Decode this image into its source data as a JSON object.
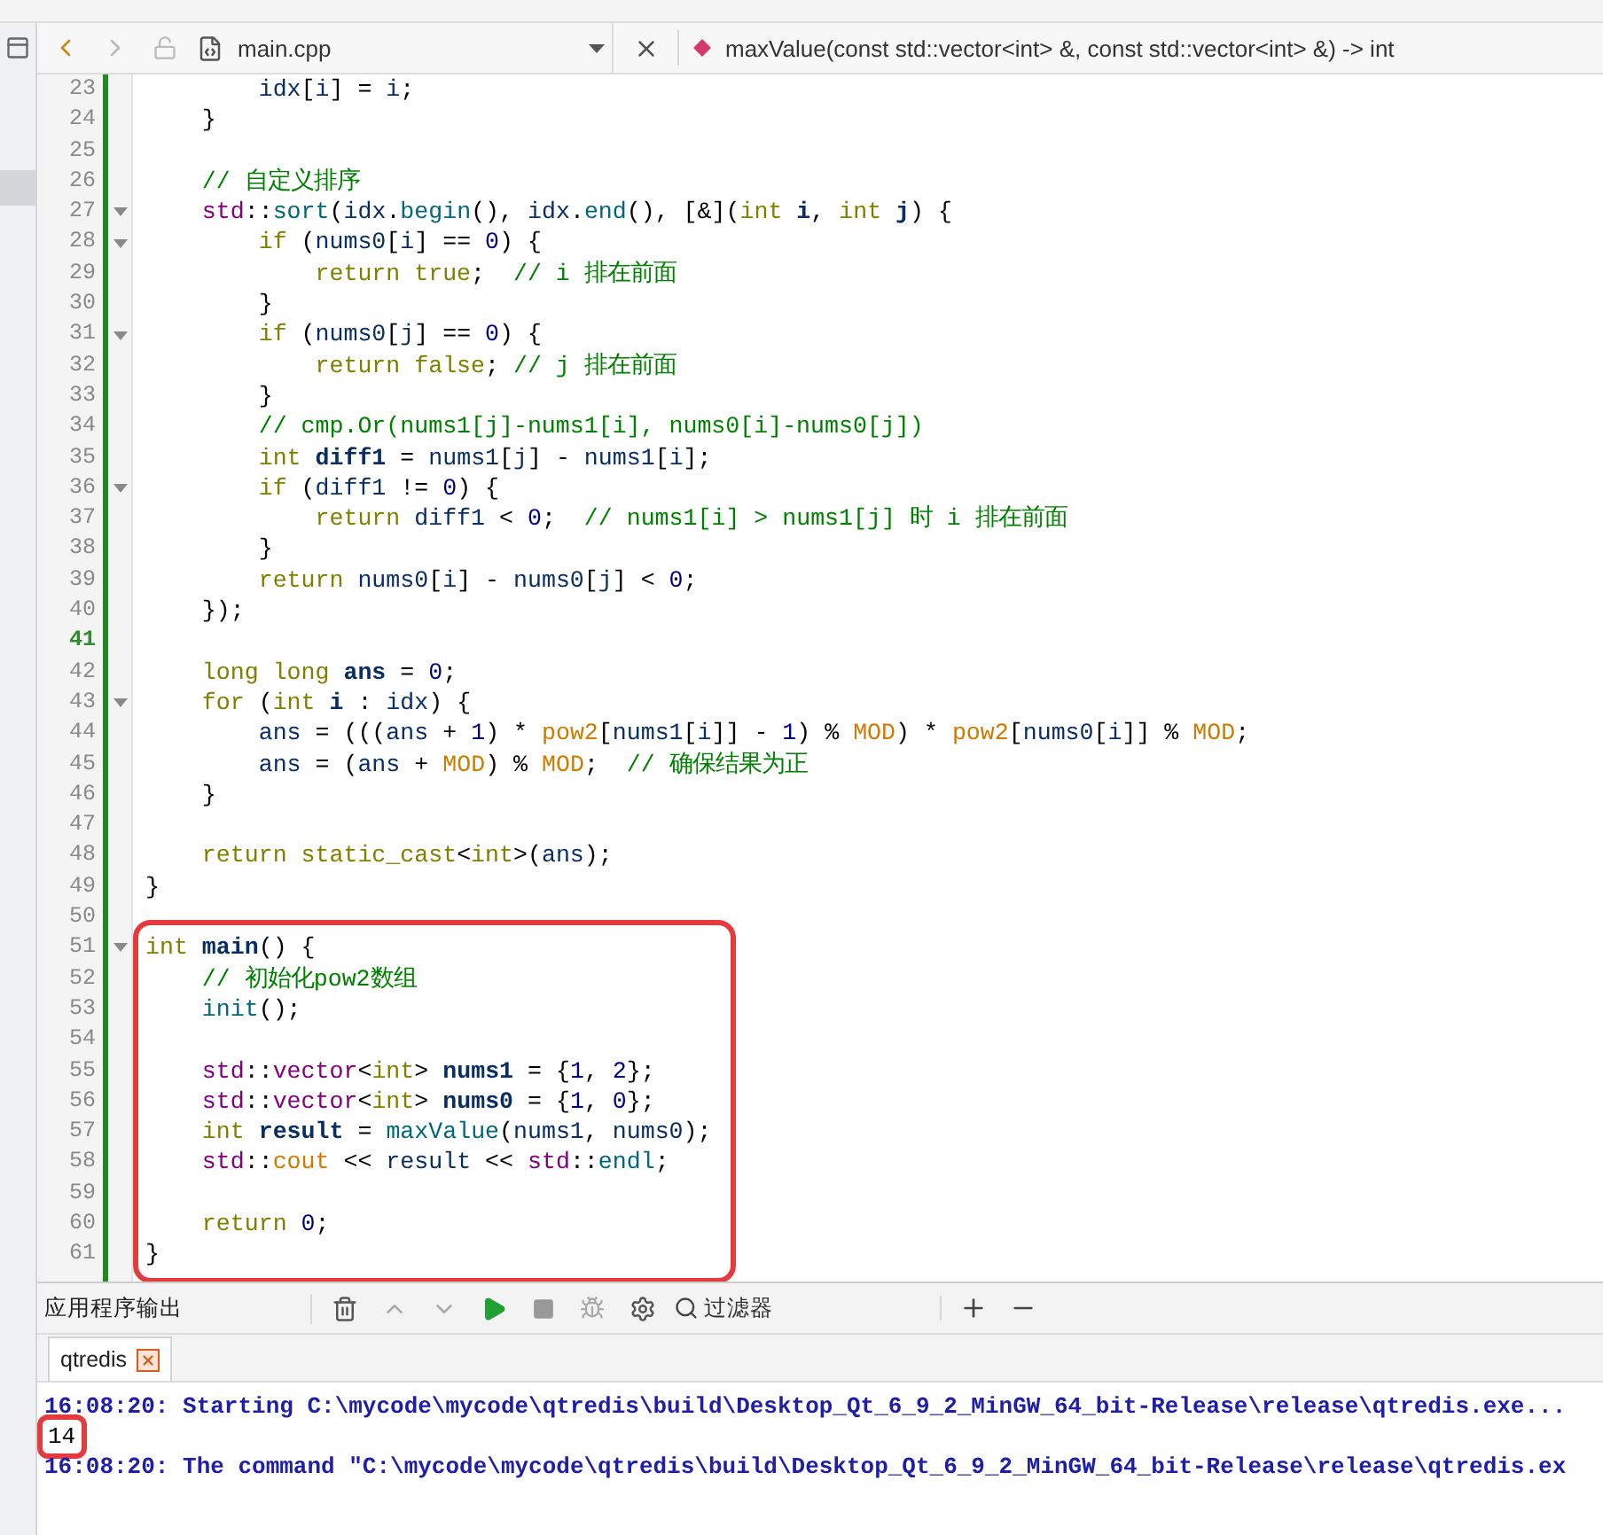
{
  "editor_toolbar": {
    "file_name": "main.cpp",
    "function_signature": "maxValue(const std::vector<int> &, const std::vector<int> &) -> int"
  },
  "code": {
    "lines": [
      {
        "number": "23",
        "fold": false,
        "current": false,
        "boxed": false,
        "tokens": [
          {
            "kind": "v",
            "text": "        idx"
          },
          {
            "kind": "p",
            "text": "["
          },
          {
            "kind": "v",
            "text": "i"
          },
          {
            "kind": "p",
            "text": "] = "
          },
          {
            "kind": "v",
            "text": "i"
          },
          {
            "kind": "p",
            "text": ";"
          }
        ]
      },
      {
        "number": "24",
        "fold": false,
        "current": false,
        "boxed": false,
        "tokens": [
          {
            "kind": "p",
            "text": "    }"
          }
        ]
      },
      {
        "number": "25",
        "fold": false,
        "current": false,
        "boxed": false
      },
      {
        "number": "26",
        "fold": false,
        "current": false,
        "boxed": false,
        "tokens": [
          {
            "kind": "c",
            "text": "    // 自定义排序"
          }
        ]
      },
      {
        "number": "27",
        "fold": true,
        "current": false,
        "boxed": false,
        "tokens": [
          {
            "kind": "s",
            "text": "    std"
          },
          {
            "kind": "p",
            "text": "::"
          },
          {
            "kind": "f",
            "text": "sort"
          },
          {
            "kind": "p",
            "text": "("
          },
          {
            "kind": "v",
            "text": "idx"
          },
          {
            "kind": "p",
            "text": "."
          },
          {
            "kind": "f",
            "text": "begin"
          },
          {
            "kind": "p",
            "text": "(), "
          },
          {
            "kind": "v",
            "text": "idx"
          },
          {
            "kind": "p",
            "text": "."
          },
          {
            "kind": "f",
            "text": "end"
          },
          {
            "kind": "p",
            "text": "(), [&]("
          },
          {
            "kind": "k",
            "text": "int "
          },
          {
            "kind": "d",
            "text": "i"
          },
          {
            "kind": "p",
            "text": ", "
          },
          {
            "kind": "k",
            "text": "int "
          },
          {
            "kind": "d",
            "text": "j"
          },
          {
            "kind": "p",
            "text": ") {"
          }
        ]
      },
      {
        "number": "28",
        "fold": true,
        "current": false,
        "boxed": false,
        "tokens": [
          {
            "kind": "k",
            "text": "        if"
          },
          {
            "kind": "p",
            "text": " ("
          },
          {
            "kind": "v",
            "text": "nums0"
          },
          {
            "kind": "p",
            "text": "["
          },
          {
            "kind": "v",
            "text": "i"
          },
          {
            "kind": "p",
            "text": "] == "
          },
          {
            "kind": "n",
            "text": "0"
          },
          {
            "kind": "p",
            "text": ") {"
          }
        ]
      },
      {
        "number": "29",
        "fold": false,
        "current": false,
        "boxed": false,
        "tokens": [
          {
            "kind": "k",
            "text": "            return true"
          },
          {
            "kind": "p",
            "text": ";  "
          },
          {
            "kind": "c",
            "text": "// i 排在前面"
          }
        ]
      },
      {
        "number": "30",
        "fold": false,
        "current": false,
        "boxed": false,
        "tokens": [
          {
            "kind": "p",
            "text": "        }"
          }
        ]
      },
      {
        "number": "31",
        "fold": true,
        "current": false,
        "boxed": false,
        "tokens": [
          {
            "kind": "k",
            "text": "        if"
          },
          {
            "kind": "p",
            "text": " ("
          },
          {
            "kind": "v",
            "text": "nums0"
          },
          {
            "kind": "p",
            "text": "["
          },
          {
            "kind": "v",
            "text": "j"
          },
          {
            "kind": "p",
            "text": "] == "
          },
          {
            "kind": "n",
            "text": "0"
          },
          {
            "kind": "p",
            "text": ") {"
          }
        ]
      },
      {
        "number": "32",
        "fold": false,
        "current": false,
        "boxed": false,
        "tokens": [
          {
            "kind": "k",
            "text": "            return false"
          },
          {
            "kind": "p",
            "text": "; "
          },
          {
            "kind": "c",
            "text": "// j 排在前面"
          }
        ]
      },
      {
        "number": "33",
        "fold": false,
        "current": false,
        "boxed": false,
        "tokens": [
          {
            "kind": "p",
            "text": "        }"
          }
        ]
      },
      {
        "number": "34",
        "fold": false,
        "current": false,
        "boxed": false,
        "tokens": [
          {
            "kind": "c",
            "text": "        // cmp.Or(nums1[j]-nums1[i], nums0[i]-nums0[j])"
          }
        ]
      },
      {
        "number": "35",
        "fold": false,
        "current": false,
        "boxed": false,
        "tokens": [
          {
            "kind": "k",
            "text": "        int "
          },
          {
            "kind": "d",
            "text": "diff1"
          },
          {
            "kind": "p",
            "text": " = "
          },
          {
            "kind": "v",
            "text": "nums1"
          },
          {
            "kind": "p",
            "text": "["
          },
          {
            "kind": "v",
            "text": "j"
          },
          {
            "kind": "p",
            "text": "] - "
          },
          {
            "kind": "v",
            "text": "nums1"
          },
          {
            "kind": "p",
            "text": "["
          },
          {
            "kind": "v",
            "text": "i"
          },
          {
            "kind": "p",
            "text": "];"
          }
        ]
      },
      {
        "number": "36",
        "fold": true,
        "current": false,
        "boxed": false,
        "tokens": [
          {
            "kind": "k",
            "text": "        if"
          },
          {
            "kind": "p",
            "text": " ("
          },
          {
            "kind": "v",
            "text": "diff1"
          },
          {
            "kind": "p",
            "text": " != "
          },
          {
            "kind": "n",
            "text": "0"
          },
          {
            "kind": "p",
            "text": ") {"
          }
        ]
      },
      {
        "number": "37",
        "fold": false,
        "current": false,
        "boxed": false,
        "tokens": [
          {
            "kind": "k",
            "text": "            return "
          },
          {
            "kind": "v",
            "text": "diff1"
          },
          {
            "kind": "p",
            "text": " < "
          },
          {
            "kind": "n",
            "text": "0"
          },
          {
            "kind": "p",
            "text": ";  "
          },
          {
            "kind": "c",
            "text": "// nums1[i] > nums1[j] 时 i 排在前面"
          }
        ]
      },
      {
        "number": "38",
        "fold": false,
        "current": false,
        "boxed": false,
        "tokens": [
          {
            "kind": "p",
            "text": "        }"
          }
        ]
      },
      {
        "number": "39",
        "fold": false,
        "current": false,
        "boxed": false,
        "tokens": [
          {
            "kind": "k",
            "text": "        return "
          },
          {
            "kind": "v",
            "text": "nums0"
          },
          {
            "kind": "p",
            "text": "["
          },
          {
            "kind": "v",
            "text": "i"
          },
          {
            "kind": "p",
            "text": "] - "
          },
          {
            "kind": "v",
            "text": "nums0"
          },
          {
            "kind": "p",
            "text": "["
          },
          {
            "kind": "v",
            "text": "j"
          },
          {
            "kind": "p",
            "text": "] < "
          },
          {
            "kind": "n",
            "text": "0"
          },
          {
            "kind": "p",
            "text": ";"
          }
        ]
      },
      {
        "number": "40",
        "fold": false,
        "current": false,
        "boxed": false,
        "tokens": [
          {
            "kind": "p",
            "text": "    });"
          }
        ]
      },
      {
        "number": "41",
        "fold": false,
        "current": true,
        "boxed": false
      },
      {
        "number": "42",
        "fold": false,
        "current": false,
        "boxed": false,
        "tokens": [
          {
            "kind": "k",
            "text": "    long long "
          },
          {
            "kind": "d",
            "text": "ans"
          },
          {
            "kind": "p",
            "text": " = "
          },
          {
            "kind": "n",
            "text": "0"
          },
          {
            "kind": "p",
            "text": ";"
          }
        ]
      },
      {
        "number": "43",
        "fold": true,
        "current": false,
        "boxed": false,
        "tokens": [
          {
            "kind": "k",
            "text": "    for"
          },
          {
            "kind": "p",
            "text": " ("
          },
          {
            "kind": "k",
            "text": "int "
          },
          {
            "kind": "d",
            "text": "i"
          },
          {
            "kind": "p",
            "text": " : "
          },
          {
            "kind": "v",
            "text": "idx"
          },
          {
            "kind": "p",
            "text": ") {"
          }
        ]
      },
      {
        "number": "44",
        "fold": false,
        "current": false,
        "boxed": false,
        "tokens": [
          {
            "kind": "v",
            "text": "        ans"
          },
          {
            "kind": "p",
            "text": " = ((("
          },
          {
            "kind": "v",
            "text": "ans"
          },
          {
            "kind": "p",
            "text": " + "
          },
          {
            "kind": "n",
            "text": "1"
          },
          {
            "kind": "p",
            "text": ") * "
          },
          {
            "kind": "m",
            "text": "pow2"
          },
          {
            "kind": "p",
            "text": "["
          },
          {
            "kind": "v",
            "text": "nums1"
          },
          {
            "kind": "p",
            "text": "["
          },
          {
            "kind": "v",
            "text": "i"
          },
          {
            "kind": "p",
            "text": "]] - "
          },
          {
            "kind": "n",
            "text": "1"
          },
          {
            "kind": "p",
            "text": ") % "
          },
          {
            "kind": "m",
            "text": "MOD"
          },
          {
            "kind": "p",
            "text": ") * "
          },
          {
            "kind": "m",
            "text": "pow2"
          },
          {
            "kind": "p",
            "text": "["
          },
          {
            "kind": "v",
            "text": "nums0"
          },
          {
            "kind": "p",
            "text": "["
          },
          {
            "kind": "v",
            "text": "i"
          },
          {
            "kind": "p",
            "text": "]] % "
          },
          {
            "kind": "m",
            "text": "MOD"
          },
          {
            "kind": "p",
            "text": ";"
          }
        ]
      },
      {
        "number": "45",
        "fold": false,
        "current": false,
        "boxed": false,
        "tokens": [
          {
            "kind": "v",
            "text": "        ans"
          },
          {
            "kind": "p",
            "text": " = ("
          },
          {
            "kind": "v",
            "text": "ans"
          },
          {
            "kind": "p",
            "text": " + "
          },
          {
            "kind": "m",
            "text": "MOD"
          },
          {
            "kind": "p",
            "text": ") % "
          },
          {
            "kind": "m",
            "text": "MOD"
          },
          {
            "kind": "p",
            "text": ";  "
          },
          {
            "kind": "c",
            "text": "// 确保结果为正"
          }
        ]
      },
      {
        "number": "46",
        "fold": false,
        "current": false,
        "boxed": false,
        "tokens": [
          {
            "kind": "p",
            "text": "    }"
          }
        ]
      },
      {
        "number": "47",
        "fold": false,
        "current": false,
        "boxed": false
      },
      {
        "number": "48",
        "fold": false,
        "current": false,
        "boxed": false,
        "tokens": [
          {
            "kind": "k",
            "text": "    return static_cast"
          },
          {
            "kind": "p",
            "text": "<"
          },
          {
            "kind": "k",
            "text": "int"
          },
          {
            "kind": "p",
            "text": ">("
          },
          {
            "kind": "v",
            "text": "ans"
          },
          {
            "kind": "p",
            "text": ");"
          }
        ]
      },
      {
        "number": "49",
        "fold": false,
        "current": false,
        "boxed": false,
        "tokens": [
          {
            "kind": "p",
            "text": "}"
          }
        ]
      },
      {
        "number": "50",
        "fold": false,
        "current": false,
        "boxed": false
      },
      {
        "number": "51",
        "fold": true,
        "current": false,
        "boxed": true,
        "tokens": [
          {
            "kind": "k",
            "text": "int "
          },
          {
            "kind": "d",
            "text": "main"
          },
          {
            "kind": "p",
            "text": "() {"
          }
        ]
      },
      {
        "number": "52",
        "fold": false,
        "current": false,
        "boxed": true,
        "tokens": [
          {
            "kind": "c",
            "text": "    // 初始化pow2数组"
          }
        ]
      },
      {
        "number": "53",
        "fold": false,
        "current": false,
        "boxed": true,
        "tokens": [
          {
            "kind": "f",
            "text": "    init"
          },
          {
            "kind": "p",
            "text": "();"
          }
        ]
      },
      {
        "number": "54",
        "fold": false,
        "current": false,
        "boxed": true
      },
      {
        "number": "55",
        "fold": false,
        "current": false,
        "boxed": true,
        "tokens": [
          {
            "kind": "s",
            "text": "    std"
          },
          {
            "kind": "p",
            "text": "::"
          },
          {
            "kind": "s",
            "text": "vector"
          },
          {
            "kind": "p",
            "text": "<"
          },
          {
            "kind": "k",
            "text": "int"
          },
          {
            "kind": "p",
            "text": "> "
          },
          {
            "kind": "d",
            "text": "nums1"
          },
          {
            "kind": "p",
            "text": " = {"
          },
          {
            "kind": "n",
            "text": "1"
          },
          {
            "kind": "p",
            "text": ", "
          },
          {
            "kind": "n",
            "text": "2"
          },
          {
            "kind": "p",
            "text": "};"
          }
        ]
      },
      {
        "number": "56",
        "fold": false,
        "current": false,
        "boxed": true,
        "tokens": [
          {
            "kind": "s",
            "text": "    std"
          },
          {
            "kind": "p",
            "text": "::"
          },
          {
            "kind": "s",
            "text": "vector"
          },
          {
            "kind": "p",
            "text": "<"
          },
          {
            "kind": "k",
            "text": "int"
          },
          {
            "kind": "p",
            "text": "> "
          },
          {
            "kind": "d",
            "text": "nums0"
          },
          {
            "kind": "p",
            "text": " = {"
          },
          {
            "kind": "n",
            "text": "1"
          },
          {
            "kind": "p",
            "text": ", "
          },
          {
            "kind": "n",
            "text": "0"
          },
          {
            "kind": "p",
            "text": "};"
          }
        ]
      },
      {
        "number": "57",
        "fold": false,
        "current": false,
        "boxed": true,
        "tokens": [
          {
            "kind": "k",
            "text": "    int "
          },
          {
            "kind": "d",
            "text": "result"
          },
          {
            "kind": "p",
            "text": " = "
          },
          {
            "kind": "f",
            "text": "maxValue"
          },
          {
            "kind": "p",
            "text": "("
          },
          {
            "kind": "v",
            "text": "nums1"
          },
          {
            "kind": "p",
            "text": ", "
          },
          {
            "kind": "v",
            "text": "nums0"
          },
          {
            "kind": "p",
            "text": ");"
          }
        ]
      },
      {
        "number": "58",
        "fold": false,
        "current": false,
        "boxed": true,
        "tokens": [
          {
            "kind": "s",
            "text": "    std"
          },
          {
            "kind": "p",
            "text": "::"
          },
          {
            "kind": "m",
            "text": "cout"
          },
          {
            "kind": "p",
            "text": " << "
          },
          {
            "kind": "v",
            "text": "result"
          },
          {
            "kind": "p",
            "text": " << "
          },
          {
            "kind": "s",
            "text": "std"
          },
          {
            "kind": "p",
            "text": "::"
          },
          {
            "kind": "f",
            "text": "endl"
          },
          {
            "kind": "p",
            "text": ";"
          }
        ]
      },
      {
        "number": "59",
        "fold": false,
        "current": false,
        "boxed": true
      },
      {
        "number": "60",
        "fold": false,
        "current": false,
        "boxed": true,
        "tokens": [
          {
            "kind": "k",
            "text": "    return "
          },
          {
            "kind": "n",
            "text": "0"
          },
          {
            "kind": "p",
            "text": ";"
          }
        ]
      },
      {
        "number": "61",
        "fold": false,
        "current": false,
        "boxed": true,
        "tokens": [
          {
            "kind": "p",
            "text": "}"
          }
        ]
      }
    ]
  },
  "output_panel": {
    "title": "应用程序输出",
    "filter_placeholder": "过滤器",
    "tabs": [
      {
        "label": "qtredis",
        "selected": true
      }
    ],
    "lines": [
      {
        "kind": "status",
        "boxed": false,
        "text": "16:08:20: Starting C:\\mycode\\mycode\\qtredis\\build\\Desktop_Qt_6_9_2_MinGW_64_bit-Release\\release\\qtredis.exe..."
      },
      {
        "kind": "program",
        "boxed": true,
        "text": "14"
      },
      {
        "kind": "status",
        "boxed": false,
        "text": "16:08:20: The command \"C:\\mycode\\mycode\\qtredis\\build\\Desktop_Qt_6_9_2_MinGW_64_bit-Release\\release\\qtredis.ex"
      }
    ]
  }
}
